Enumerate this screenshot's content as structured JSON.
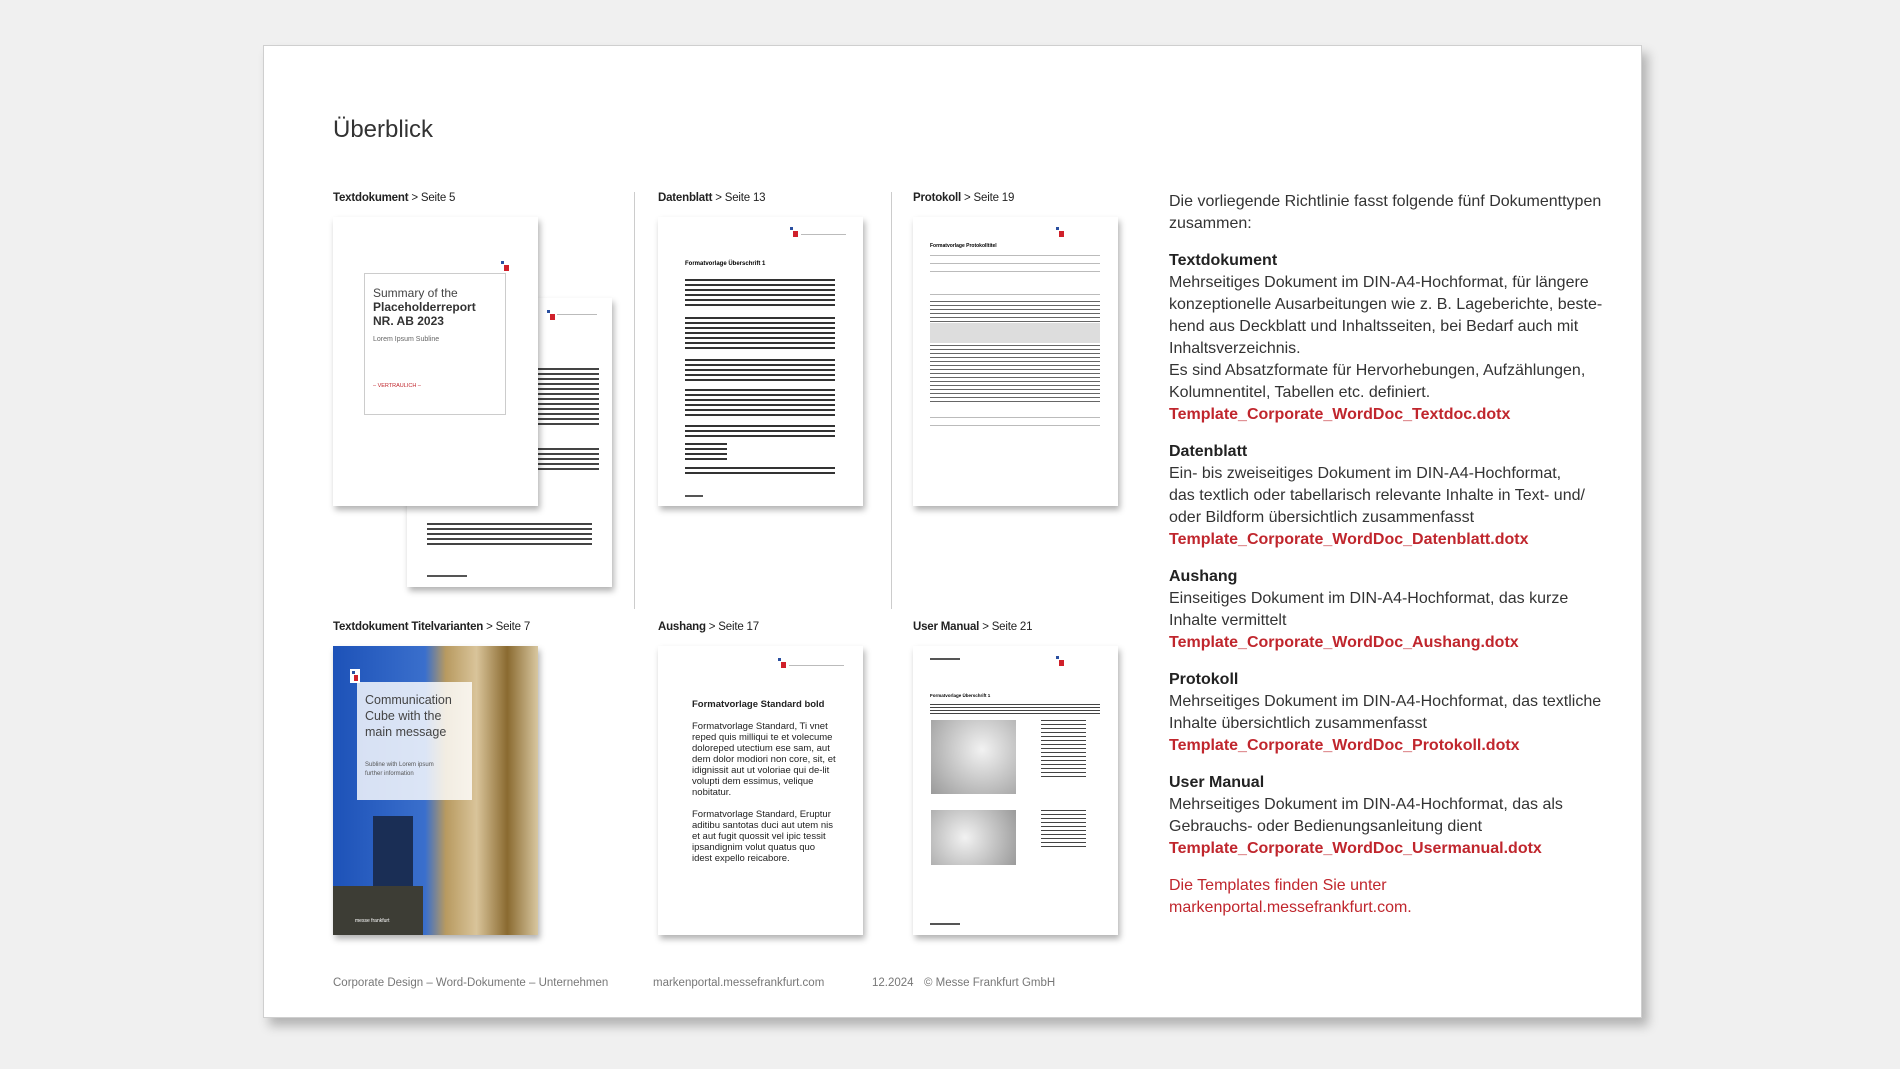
{
  "title": "Überblick",
  "thumbnails": [
    {
      "name": "Textdokument",
      "page": "> Seite 5",
      "cover": {
        "line1": "Summary of the",
        "line2": "Placeholderreport",
        "line3": "NR. AB 2023",
        "subline": "Lorem Ipsum Subline",
        "tag": "– VERTRAULICH –"
      }
    },
    {
      "name": "Datenblatt",
      "page": "> Seite 13",
      "heading": "Formatvorlage Überschrift 1"
    },
    {
      "name": "Protokoll",
      "page": "> Seite 19",
      "heading": "Formatvorlage Protokolltitel"
    },
    {
      "name": "Textdokument Titelvarianten",
      "page": "> Seite 7",
      "cover": {
        "line1": "Communication",
        "line2": "Cube with the",
        "line3": "main message",
        "subline1": "Subline with Lorem ipsum",
        "subline2": "further information",
        "brand": "messe frankfurt"
      }
    },
    {
      "name": "Aushang",
      "page": "> Seite 17",
      "heading": "Formatvorlage Standard bold",
      "p1": "Formatvorlage Standard, Ti vnet reped quis milliqui te et volecume doloreped utectium ese sam, aut dem dolor modiori non core, sit, et idignissit aut ut voloriae qui de-lit volupti dem essimus, velique nobitatur.",
      "p2": "Formatvorlage Standard, Eruptur aditibu santotas duci aut utem nis et aut fugit quossit vel ipic tessit ipsandignim volut quatus quo idest expello reicabore."
    },
    {
      "name": "User Manual",
      "page": "> Seite 21",
      "heading": "Formatvorlage Überschrift 1"
    }
  ],
  "intro": [
    "Die vorliegende Richtlinie fasst folgende fünf Dokumenttypen",
    "zusammen:"
  ],
  "sections": [
    {
      "heading": "Textdokument",
      "lines": [
        "Mehrseitiges Dokument im DIN-A4-Hochformat, für längere",
        "konzeptionelle Ausarbeitungen wie z. B. Lageberichte, beste-",
        "hend aus Deckblatt und Inhaltsseiten, bei Bedarf auch mit",
        "Inhaltsverzeichnis.",
        "Es sind Absatzformate für Hervorhebungen, Aufzählungen,",
        "Kolumnentitel, Tabellen etc. definiert."
      ],
      "file": "Template_Corporate_WordDoc_Textdoc.dotx"
    },
    {
      "heading": "Datenblatt",
      "lines": [
        "Ein- bis zweiseitiges Dokument im DIN-A4-Hochformat,",
        "das textlich oder tabellarisch relevante Inhalte in Text- und/",
        "oder Bildform übersichtlich zusammenfasst"
      ],
      "file": "Template_Corporate_WordDoc_Datenblatt.dotx"
    },
    {
      "heading": "Aushang",
      "lines": [
        "Einseitiges Dokument im DIN-A4-Hochformat, das kurze",
        "Inhalte vermittelt"
      ],
      "file": "Template_Corporate_WordDoc_Aushang.dotx"
    },
    {
      "heading": "Protokoll",
      "lines": [
        "Mehrseitiges Dokument im DIN-A4-Hochformat, das textliche",
        "Inhalte übersichtlich zusammenfasst"
      ],
      "file": "Template_Corporate_WordDoc_Protokoll.dotx"
    },
    {
      "heading": "User Manual",
      "lines": [
        "Mehrseitiges Dokument im DIN-A4-Hochformat, das als",
        "Gebrauchs- oder Bedienungsanleitung dient"
      ],
      "file": "Template_Corporate_WordDoc_Usermanual.dotx"
    }
  ],
  "note": [
    "Die Templates finden Sie unter",
    "markenportal.messefrankfurt.com."
  ],
  "footer": {
    "left": "Corporate Design – Word-Dokumente – Unternehmen",
    "center": "markenportal.messefrankfurt.com",
    "date": "12.2024",
    "copyright": "© Messe Frankfurt GmbH"
  },
  "colors": {
    "accent": "#c0262d",
    "text": "#333333",
    "background": "#f0f0f0"
  }
}
